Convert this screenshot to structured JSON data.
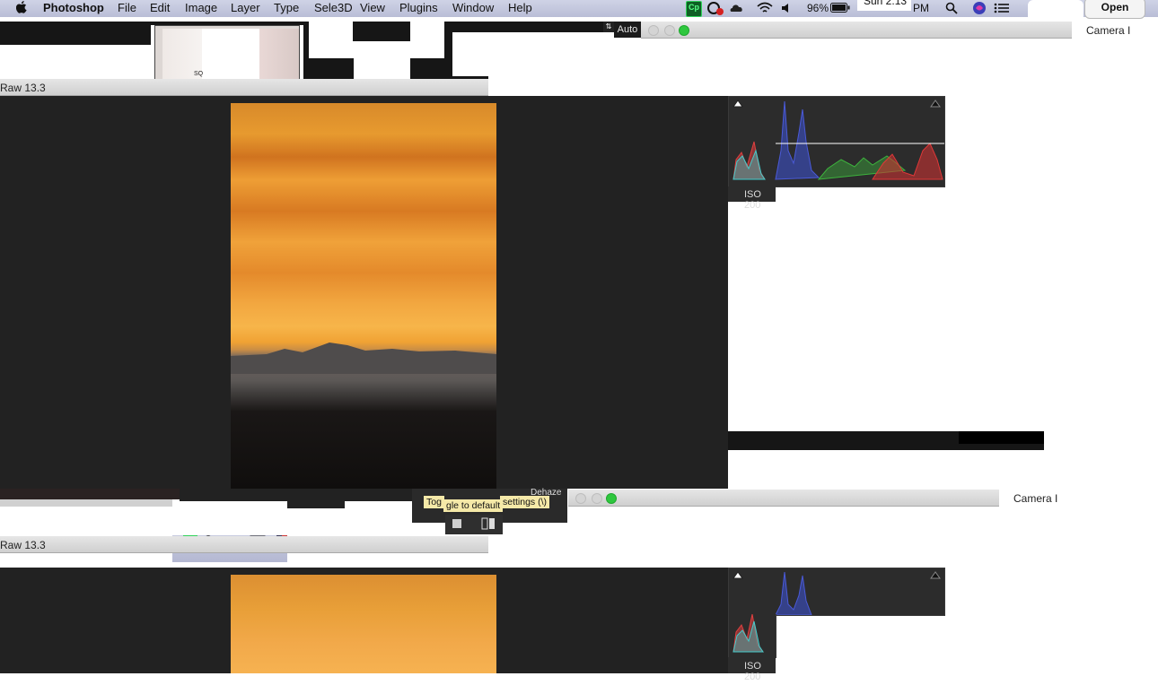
{
  "menubar": {
    "app_name": "Photoshop",
    "items": [
      "File",
      "Edit",
      "Image",
      "Layer",
      "Type",
      "Sele3D",
      "View",
      "Plugins",
      "Window",
      "Help"
    ],
    "battery": "96%",
    "clock": "Sun 2:13",
    "clock_suffix": "PM",
    "open_button": "Open"
  },
  "toolbar": {
    "auto_label": "Auto",
    "thumb_label": "SQ"
  },
  "top_window": {
    "title_left": "Raw 13.3",
    "title_right": "Camera I",
    "iso": "ISO 200"
  },
  "bottom_window": {
    "title_left": "Raw 13.3",
    "title_right": "Camera I",
    "iso": "ISO 200"
  },
  "tooltip": {
    "part1": "Tog",
    "part2": "gle to default",
    "part3": "settings (\\)"
  },
  "panel": {
    "dehaze_label": "Dehaze"
  },
  "colors": {
    "canvas_bg": "#222222",
    "traffic_green": "#2ec73e",
    "tooltip_bg": "#f5e9a8"
  }
}
